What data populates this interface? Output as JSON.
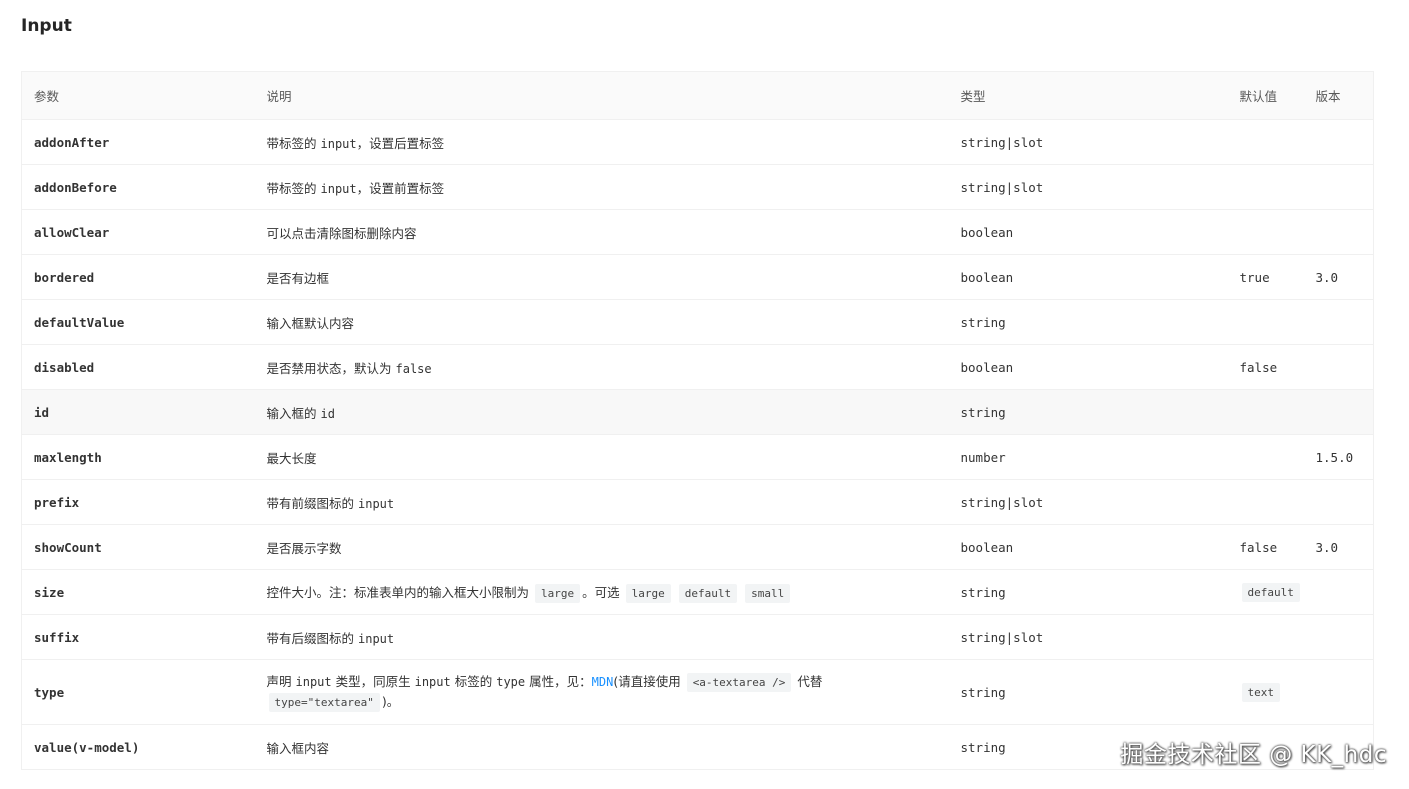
{
  "page": {
    "title": "Input"
  },
  "table": {
    "headers": {
      "param": "参数",
      "desc": "说明",
      "type": "类型",
      "default": "默认值",
      "version": "版本"
    },
    "rows": [
      {
        "param": "addonAfter",
        "desc_pre": "带标签的",
        "desc_code": "input",
        "desc_post": "，设置后置标签",
        "type": "string|slot",
        "default": "",
        "version": ""
      },
      {
        "param": "addonBefore",
        "desc_pre": "带标签的",
        "desc_code": "input",
        "desc_post": "，设置前置标签",
        "type": "string|slot",
        "default": "",
        "version": ""
      },
      {
        "param": "allowClear",
        "desc": "可以点击清除图标删除内容",
        "type": "boolean",
        "default": "",
        "version": ""
      },
      {
        "param": "bordered",
        "desc": "是否有边框",
        "type": "boolean",
        "default": "true",
        "version": "3.0"
      },
      {
        "param": "defaultValue",
        "desc": "输入框默认内容",
        "type": "string",
        "default": "",
        "version": ""
      },
      {
        "param": "disabled",
        "desc_pre": "是否禁用状态，默认为",
        "desc_code": "false",
        "type": "boolean",
        "default": "false",
        "version": ""
      },
      {
        "param": "id",
        "desc_pre": "输入框的",
        "desc_code": "id",
        "type": "string",
        "default": "",
        "version": ""
      },
      {
        "param": "maxlength",
        "desc": "最大长度",
        "type": "number",
        "default": "",
        "version": "1.5.0"
      },
      {
        "param": "prefix",
        "desc_pre": "带有前缀图标的",
        "desc_code": "input",
        "type": "string|slot",
        "default": "",
        "version": ""
      },
      {
        "param": "showCount",
        "desc": "是否展示字数",
        "type": "boolean",
        "default": "false",
        "version": "3.0"
      },
      {
        "param": "size",
        "desc_pre": "控件大小。注：标准表单内的输入框大小限制为",
        "desc_tag1": "large",
        "desc_mid": "。可选",
        "desc_tags": [
          "large",
          "default",
          "small"
        ],
        "type": "string",
        "default": "default",
        "version": ""
      },
      {
        "param": "suffix",
        "desc_pre": "带有后缀图标的",
        "desc_code": "input",
        "type": "string|slot",
        "default": "",
        "version": ""
      },
      {
        "param": "type",
        "desc_parts": [
          "声明",
          "input",
          "类型，同原生",
          "input",
          "标签的",
          "type",
          "属性，见：",
          "MDN",
          "(请直接使用",
          "<a-textarea />",
          "代替",
          "type=\"textarea\"",
          ")。"
        ],
        "type": "string",
        "default": "text",
        "version": ""
      },
      {
        "param": "value(v-model)",
        "desc": "输入框内容",
        "type": "string",
        "default": "",
        "version": ""
      }
    ]
  },
  "watermark": "掘金技术社区 @ KK_hdc",
  "colors": {
    "type_text": "#c41d7f",
    "link": "#1890ff",
    "header_bg": "#fafafa",
    "border": "#f0f0f0"
  }
}
